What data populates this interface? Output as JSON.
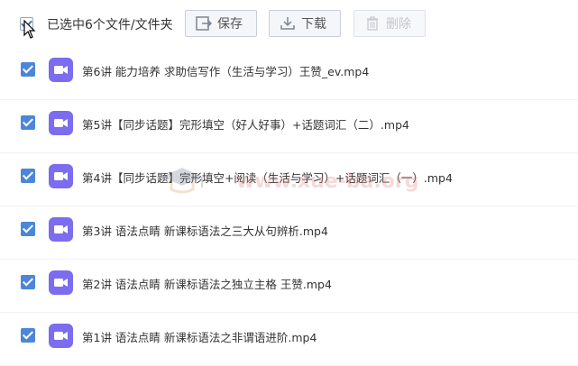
{
  "toolbar": {
    "selected_text": "已选中6个文件/文件夹",
    "save_label": "保存",
    "download_label": "下载",
    "delete_label": "删除"
  },
  "files": [
    {
      "name": "第6讲 能力培养 求助信写作（生活与学习）王赞_ev.mp4",
      "checked": true,
      "icon": "video-icon"
    },
    {
      "name": "第5讲【同步话题】完形填空（好人好事）+话题词汇（二）.mp4",
      "checked": true,
      "icon": "video-icon"
    },
    {
      "name": "第4讲【同步话题】完形填空+阅读（生活与学习）+话题词汇（一）.mp4",
      "checked": true,
      "icon": "video-icon"
    },
    {
      "name": "第3讲 语法点睛 新课标语法之三大从句辨析.mp4",
      "checked": true,
      "icon": "video-icon"
    },
    {
      "name": "第2讲 语法点睛 新课标语法之独立主格 王赞.mp4",
      "checked": true,
      "icon": "video-icon"
    },
    {
      "name": "第1讲 语法点睛 新课标语法之非谓语进阶.mp4",
      "checked": true,
      "icon": "video-icon"
    }
  ],
  "watermark": {
    "text": "www.xue-ba.org"
  },
  "colors": {
    "accent": "#4c86d9",
    "video_icon": "#7b6cf0"
  }
}
